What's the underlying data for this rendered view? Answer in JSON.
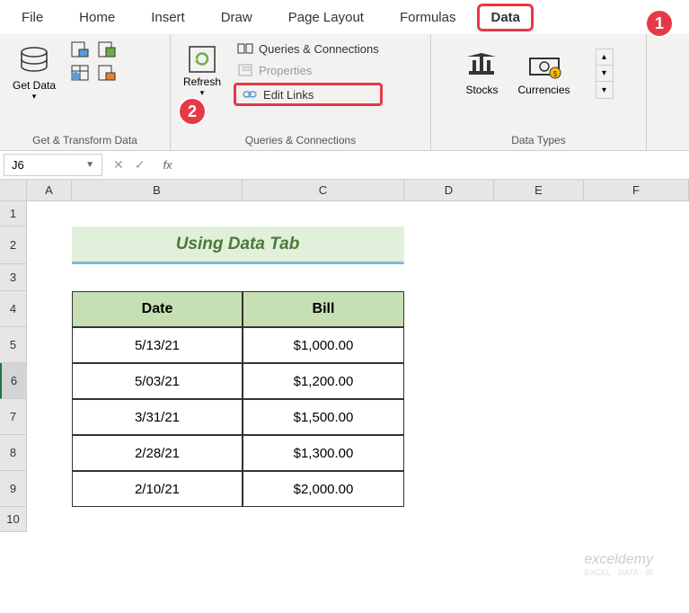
{
  "tabs": {
    "file": "File",
    "home": "Home",
    "insert": "Insert",
    "draw": "Draw",
    "page_layout": "Page Layout",
    "formulas": "Formulas",
    "data": "Data"
  },
  "ribbon": {
    "get_data": {
      "label": "Get Data",
      "group_label": "Get & Transform Data"
    },
    "refresh": {
      "label": "Refresh"
    },
    "queries_conn": "Queries & Connections",
    "properties": "Properties",
    "edit_links": "Edit Links",
    "queries_group_label": "Queries & Connections",
    "stocks": "Stocks",
    "currencies": "Currencies",
    "data_types_label": "Data Types"
  },
  "name_box": "J6",
  "formula_fx": "fx",
  "columns": [
    "A",
    "B",
    "C",
    "D",
    "E",
    "F"
  ],
  "rows": [
    "1",
    "2",
    "3",
    "4",
    "5",
    "6",
    "7",
    "8",
    "9",
    "10"
  ],
  "title": "Using Data Tab",
  "table": {
    "headers": {
      "date": "Date",
      "bill": "Bill"
    },
    "data": [
      {
        "date": "5/13/21",
        "bill": "$1,000.00"
      },
      {
        "date": "5/03/21",
        "bill": "$1,200.00"
      },
      {
        "date": "3/31/21",
        "bill": "$1,500.00"
      },
      {
        "date": "2/28/21",
        "bill": "$1,300.00"
      },
      {
        "date": "2/10/21",
        "bill": "$2,000.00"
      }
    ]
  },
  "badges": {
    "one": "1",
    "two": "2"
  },
  "watermark": {
    "main": "exceldemy",
    "sub": "EXCEL · DATA · BI"
  }
}
